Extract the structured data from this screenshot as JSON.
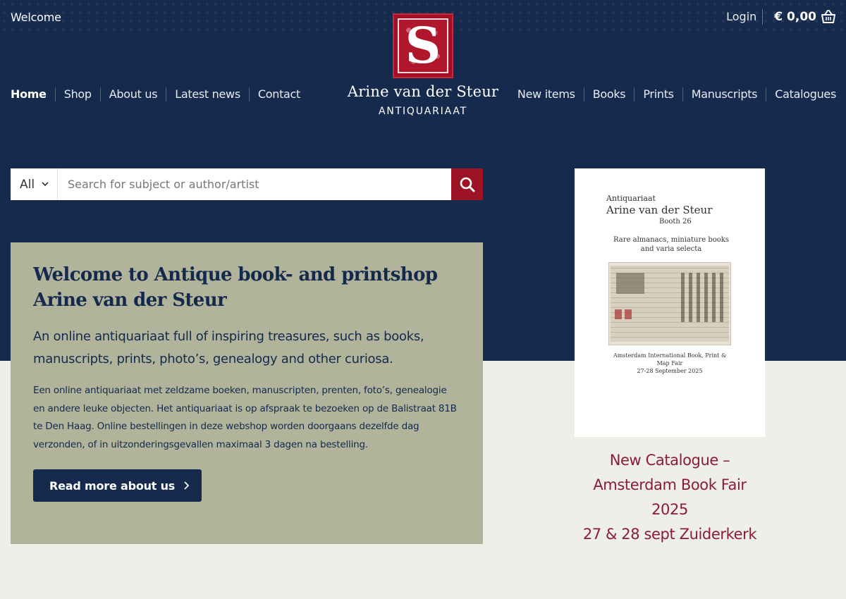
{
  "topbar": {
    "welcome": "Welcome",
    "login": "Login",
    "cart_total": "€ 0,00"
  },
  "brand": {
    "logo_letter": "S",
    "name": "Arine van der Steur",
    "subtitle": "ANTIQUARIAAT"
  },
  "nav_left": [
    {
      "label": "Home",
      "active": true
    },
    {
      "label": "Shop"
    },
    {
      "label": "About us"
    },
    {
      "label": "Latest news"
    },
    {
      "label": "Contact"
    }
  ],
  "nav_right": [
    {
      "label": "New items"
    },
    {
      "label": "Books"
    },
    {
      "label": "Prints"
    },
    {
      "label": "Manuscripts"
    },
    {
      "label": "Catalogues"
    }
  ],
  "search": {
    "category": "All",
    "placeholder": "Search for subject or author/artist"
  },
  "welcome": {
    "title": "Welcome to Antique book- and printshop Arine van der Steur",
    "lead": "An online antiquariaat full of inspiring treasures, such as books, manuscripts, prints, photo’s, genealogy and other curiosa.",
    "body": "Een online antiquariaat met zeldzame boeken, manuscripten, prenten, foto’s, genealogie en andere leuke objecten. Het antiquariaat is op afspraak te bezoeken op de Balistraat 81B te Den Haag. Online bestellingen in deze webshop worden doorgaans dezelfde dag verzonden, of in uitzonderingsgevallen maximaal 3 dagen na bestelling.",
    "button": "Read more about us"
  },
  "catalogue": {
    "cover_line1": "Antiquariaat",
    "cover_line2": "Arine van der Steur",
    "cover_line3": "Booth 26",
    "cover_line4": "Rare almanacs, miniature books and varia selecta",
    "cover_line5": "Amsterdam International Book, Print & Map Fair",
    "cover_line6": "27-28 September 2025",
    "caption_line1": "New Catalogue –",
    "caption_line2": "Amsterdam Book Fair 2025",
    "caption_line3": "27 & 28 sept Zuiderkerk"
  },
  "colors": {
    "navy": "#152a4d",
    "accent_red": "#9b1324",
    "sage": "#b1b39b",
    "caption_red": "#8c1b36",
    "background": "#efefea"
  }
}
